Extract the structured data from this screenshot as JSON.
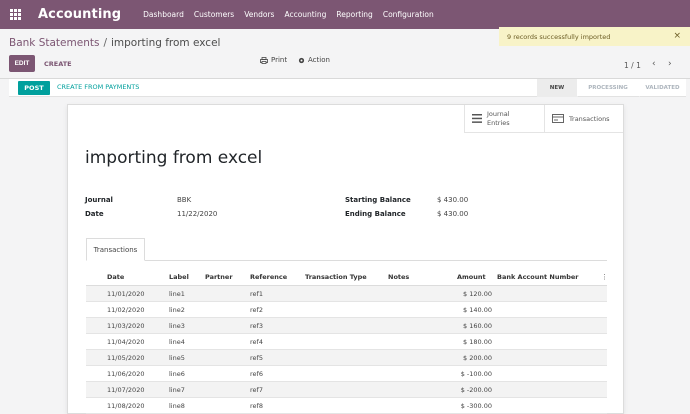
{
  "navbar": {
    "brand": "Accounting",
    "items": [
      "Dashboard",
      "Customers",
      "Vendors",
      "Accounting",
      "Reporting",
      "Configuration"
    ],
    "color": "#7c5673"
  },
  "breadcrumb": {
    "parent": "Bank Statements",
    "separator": "/",
    "current": "importing from excel"
  },
  "toolbar": {
    "edit": "EDIT",
    "create": "CREATE",
    "print": "Print",
    "action": "Action",
    "pager": "1 / 1",
    "prev": "‹",
    "next": "›"
  },
  "notification": {
    "message": "9 records successfully imported",
    "close": "×",
    "background": "#f8f3c8"
  },
  "statusbar": {
    "post": "POST",
    "create_from_payments": "CREATE FROM PAYMENTS",
    "stages": [
      "NEW",
      "PROCESSING",
      "VALIDATED"
    ],
    "active_stage": "NEW",
    "accent": "#00a09d"
  },
  "smart_buttons": {
    "journal_line1": "Journal",
    "journal_line2": "Entries",
    "transactions": "Transactions"
  },
  "record": {
    "title": "importing from excel",
    "journal_label": "Journal",
    "journal_value": "BBK",
    "date_label": "Date",
    "date_value": "11/22/2020",
    "starting_balance_label": "Starting Balance",
    "starting_balance_value": "$ 430.00",
    "ending_balance_label": "Ending Balance",
    "ending_balance_value": "$ 430.00"
  },
  "tab": {
    "label": "Transactions"
  },
  "table": {
    "headers": {
      "date": "Date",
      "label": "Label",
      "partner": "Partner",
      "reference": "Reference",
      "transaction_type": "Transaction Type",
      "notes": "Notes",
      "amount": "Amount",
      "bank_account": "Bank Account Number",
      "optional": "⋮"
    },
    "rows": [
      {
        "date": "11/01/2020",
        "label": "line1",
        "reference": "ref1",
        "amount": "$ 120.00"
      },
      {
        "date": "11/02/2020",
        "label": "line2",
        "reference": "ref2",
        "amount": "$ 140.00"
      },
      {
        "date": "11/03/2020",
        "label": "line3",
        "reference": "ref3",
        "amount": "$ 160.00"
      },
      {
        "date": "11/04/2020",
        "label": "line4",
        "reference": "ref4",
        "amount": "$ 180.00"
      },
      {
        "date": "11/05/2020",
        "label": "line5",
        "reference": "ref5",
        "amount": "$ 200.00"
      },
      {
        "date": "11/06/2020",
        "label": "line6",
        "reference": "ref6",
        "amount": "$ -100.00"
      },
      {
        "date": "11/07/2020",
        "label": "line7",
        "reference": "ref7",
        "amount": "$ -200.00"
      },
      {
        "date": "11/08/2020",
        "label": "line8",
        "reference": "ref8",
        "amount": "$ -300.00"
      }
    ]
  }
}
